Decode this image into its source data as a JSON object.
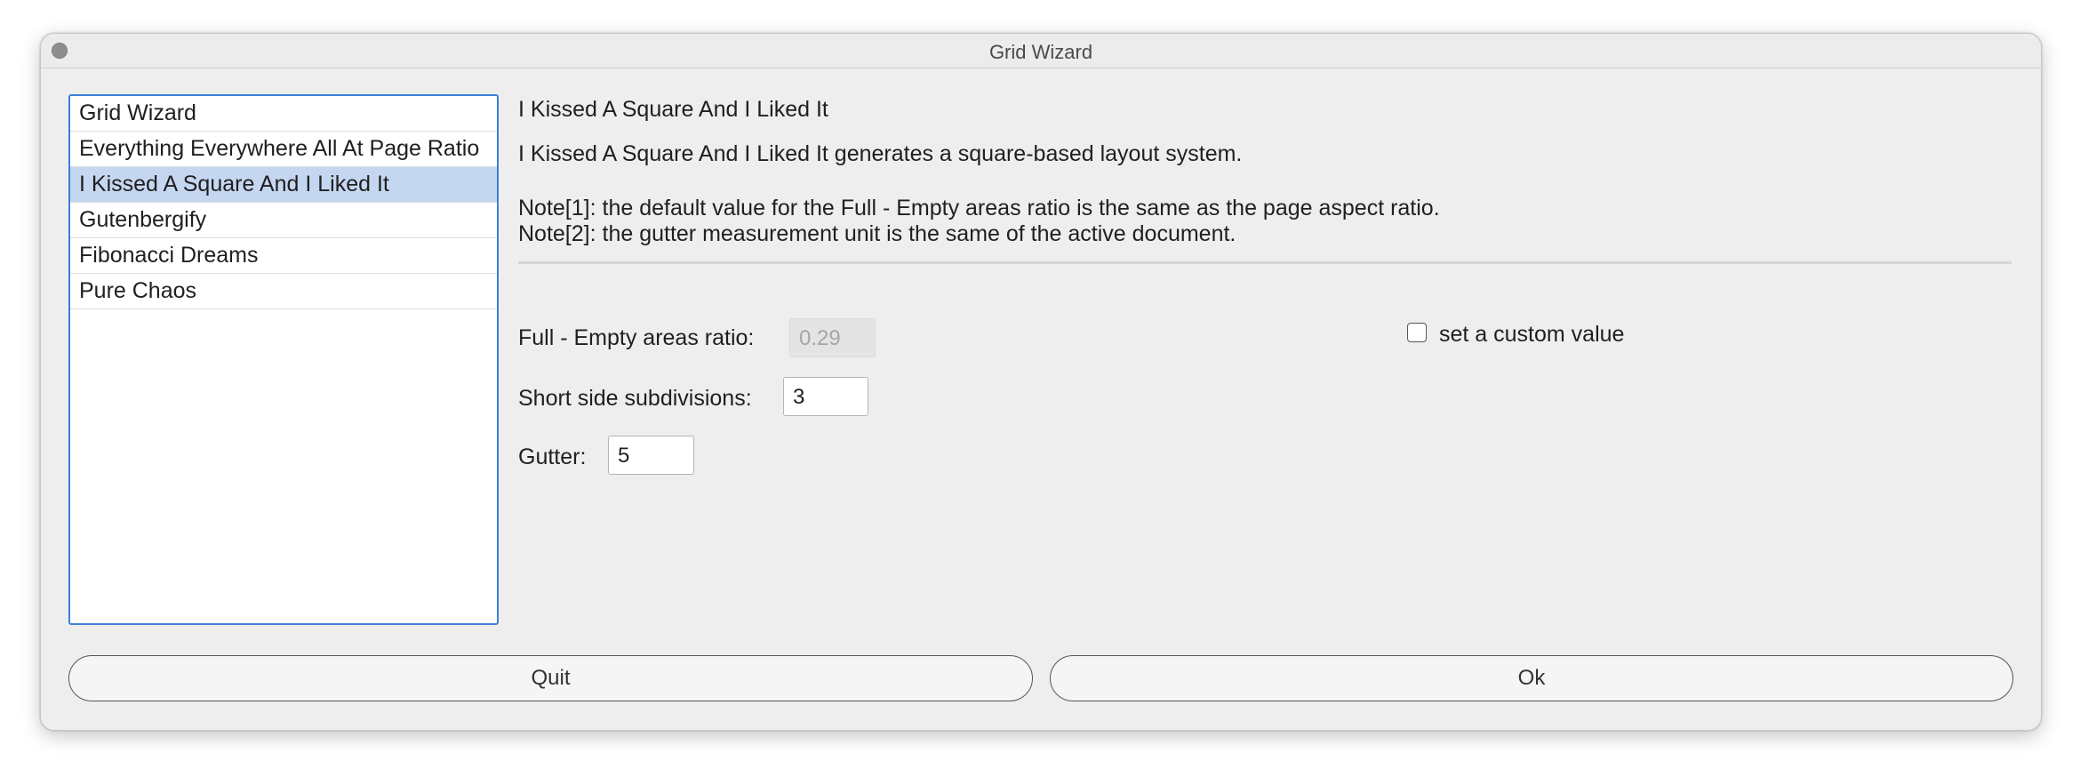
{
  "window": {
    "title": "Grid Wizard"
  },
  "list": {
    "items": [
      {
        "label": "Grid Wizard"
      },
      {
        "label": "Everything Everywhere All At Page Ratio"
      },
      {
        "label": "I Kissed A Square And I Liked It"
      },
      {
        "label": "Gutenbergify"
      },
      {
        "label": "Fibonacci Dreams"
      },
      {
        "label": "Pure Chaos"
      }
    ],
    "selected": "I Kissed A Square And I Liked It"
  },
  "panel": {
    "heading": "I Kissed A Square And I Liked It",
    "description": "I Kissed A Square And I Liked It generates a square-based layout system.",
    "note1": "Note[1]: the default value for the Full - Empty areas ratio is the same as the page aspect ratio.",
    "note2": "Note[2]: the gutter measurement unit is the same of the active document.",
    "ratio": {
      "label": "Full - Empty areas ratio:",
      "value": "0.29",
      "custom_label": "set a custom value",
      "custom_checked": false
    },
    "subdivisions": {
      "label": "Short side subdivisions:",
      "value": "3"
    },
    "gutter": {
      "label": "Gutter:",
      "value": "5"
    }
  },
  "buttons": {
    "quit": "Quit",
    "ok": "Ok"
  }
}
